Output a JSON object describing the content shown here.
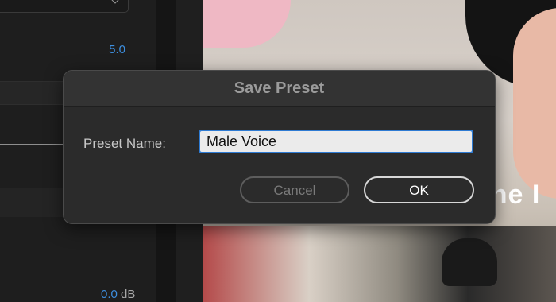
{
  "left_panel": {
    "value_top": "5.0",
    "value_bottom_number": "0.0",
    "value_bottom_unit": "dB"
  },
  "video": {
    "overlay_text": "one I"
  },
  "dialog": {
    "title": "Save Preset",
    "field_label": "Preset Name:",
    "preset_name_value": "Male Voice",
    "cancel_label": "Cancel",
    "ok_label": "OK"
  },
  "colors": {
    "accent": "#3d8fe0",
    "focus_ring": "#2e7bd3",
    "dialog_bg": "#2b2b2b"
  }
}
